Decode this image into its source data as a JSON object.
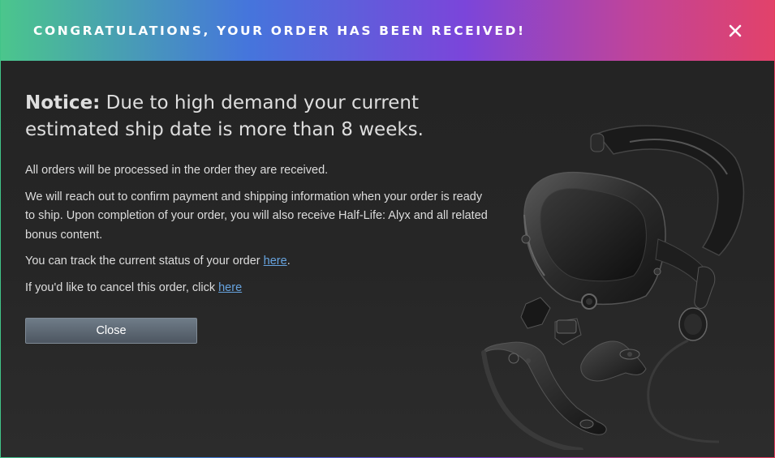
{
  "header": {
    "title": "CONGRATULATIONS, YOUR ORDER HAS BEEN RECEIVED!",
    "close_icon": "close-icon"
  },
  "notice": {
    "label": "Notice:",
    "text": " Due to high demand your current estimated ship date is more than 8 weeks."
  },
  "paragraphs": {
    "p1": "All orders will be processed in the order they are received.",
    "p2": "We will reach out to confirm payment and shipping information when your order is ready to ship. Upon completion of your order, you will also receive Half-Life: Alyx and all related bonus content.",
    "p3_prefix": "You can track the current status of your order ",
    "p3_link": "here",
    "p3_suffix": ".",
    "p4_prefix": "If you'd like to cancel this order, click ",
    "p4_link": "here"
  },
  "buttons": {
    "close_label": "Close"
  },
  "image": {
    "icon": "vr-headset-controllers-image"
  },
  "colors": {
    "accent_link": "#67a4e0",
    "body_bg": "#262626",
    "button_top": "#6f7c88",
    "button_bottom": "#4d5661"
  }
}
